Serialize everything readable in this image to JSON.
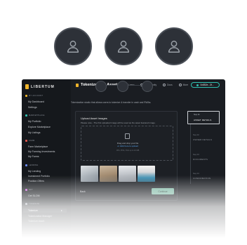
{
  "colors": {
    "accent": "#f0b52b",
    "teal": "#2fc0b0",
    "continue": "#7fb8a5",
    "link": "#5aa7f0",
    "window_bg": "#1a1d22",
    "sidebar_bg": "#15181c"
  },
  "avatars": [
    {
      "icon": "user-icon"
    },
    {
      "icon": "user-icon"
    },
    {
      "icon": "user-icon"
    }
  ],
  "app": {
    "logo": "LIBERTUM",
    "header": {
      "title": "Tokenize New Asset",
      "nav": [
        {
          "label": "Learn",
          "icon": "book-icon"
        },
        {
          "label": "Community",
          "icon": "people-icon"
        },
        {
          "label": "Docs",
          "icon": "doc-icon"
        },
        {
          "label": "More",
          "icon": "more-icon"
        }
      ],
      "wallet": "0x852e...3f..."
    },
    "subtitle": "Tokenization studio that allows users to tokenize & transfer in cash and RWAs.",
    "sidebar": {
      "sections": [
        {
          "title": "MY ACCOUNT",
          "color": "#f0b52b",
          "items": [
            "My Dashboard",
            "Settings"
          ]
        },
        {
          "title": "MARKETPLACE",
          "color": "#2fc0b0",
          "items": [
            "My Portfolio",
            "Explore Marketplace",
            "My Listings"
          ]
        },
        {
          "title": "FARM",
          "color": "#e0554b",
          "items": [
            "Farm Marketplace",
            "My Farming Investments",
            "My Farms"
          ]
        },
        {
          "title": "LENDING",
          "color": "#6c8cf5",
          "items": [
            "My Lending",
            "Investment Portfolio",
            "Position Offers"
          ]
        },
        {
          "title": "NFT",
          "color": "#c65bd8",
          "items": [
            "Get SLOM"
          ]
        },
        {
          "title": "TOKENIZE",
          "color": "#9aa0a7",
          "items": [
            "Tokenize",
            "Tokenization Manager",
            "Tokenize Asset"
          ]
        }
      ]
    },
    "card": {
      "title": "Upload Asset Images",
      "note": "Please note - The first uploaded image will be used as the asset featured image.",
      "drop_line1": "Drag and drop your file",
      "drop_line2": "or click here to upload",
      "drop_line3": "JPG, PNG, SVG up to 10 MB",
      "thumbnails": [
        "living-room-photo",
        "interior-photo",
        "kitchen-photo",
        "pool-photo"
      ],
      "back": "Back",
      "continue": "Continue"
    },
    "steps": [
      {
        "num": "Step 01",
        "label": "ASSET DETAILS",
        "active": true
      },
      {
        "num": "Step 02",
        "label": "OWNER DETAILS",
        "active": false
      },
      {
        "num": "Step 03",
        "label": "DOCUMENTS",
        "active": false
      },
      {
        "num": "Step 04",
        "label": "CONFIRMATION",
        "active": false
      }
    ]
  }
}
